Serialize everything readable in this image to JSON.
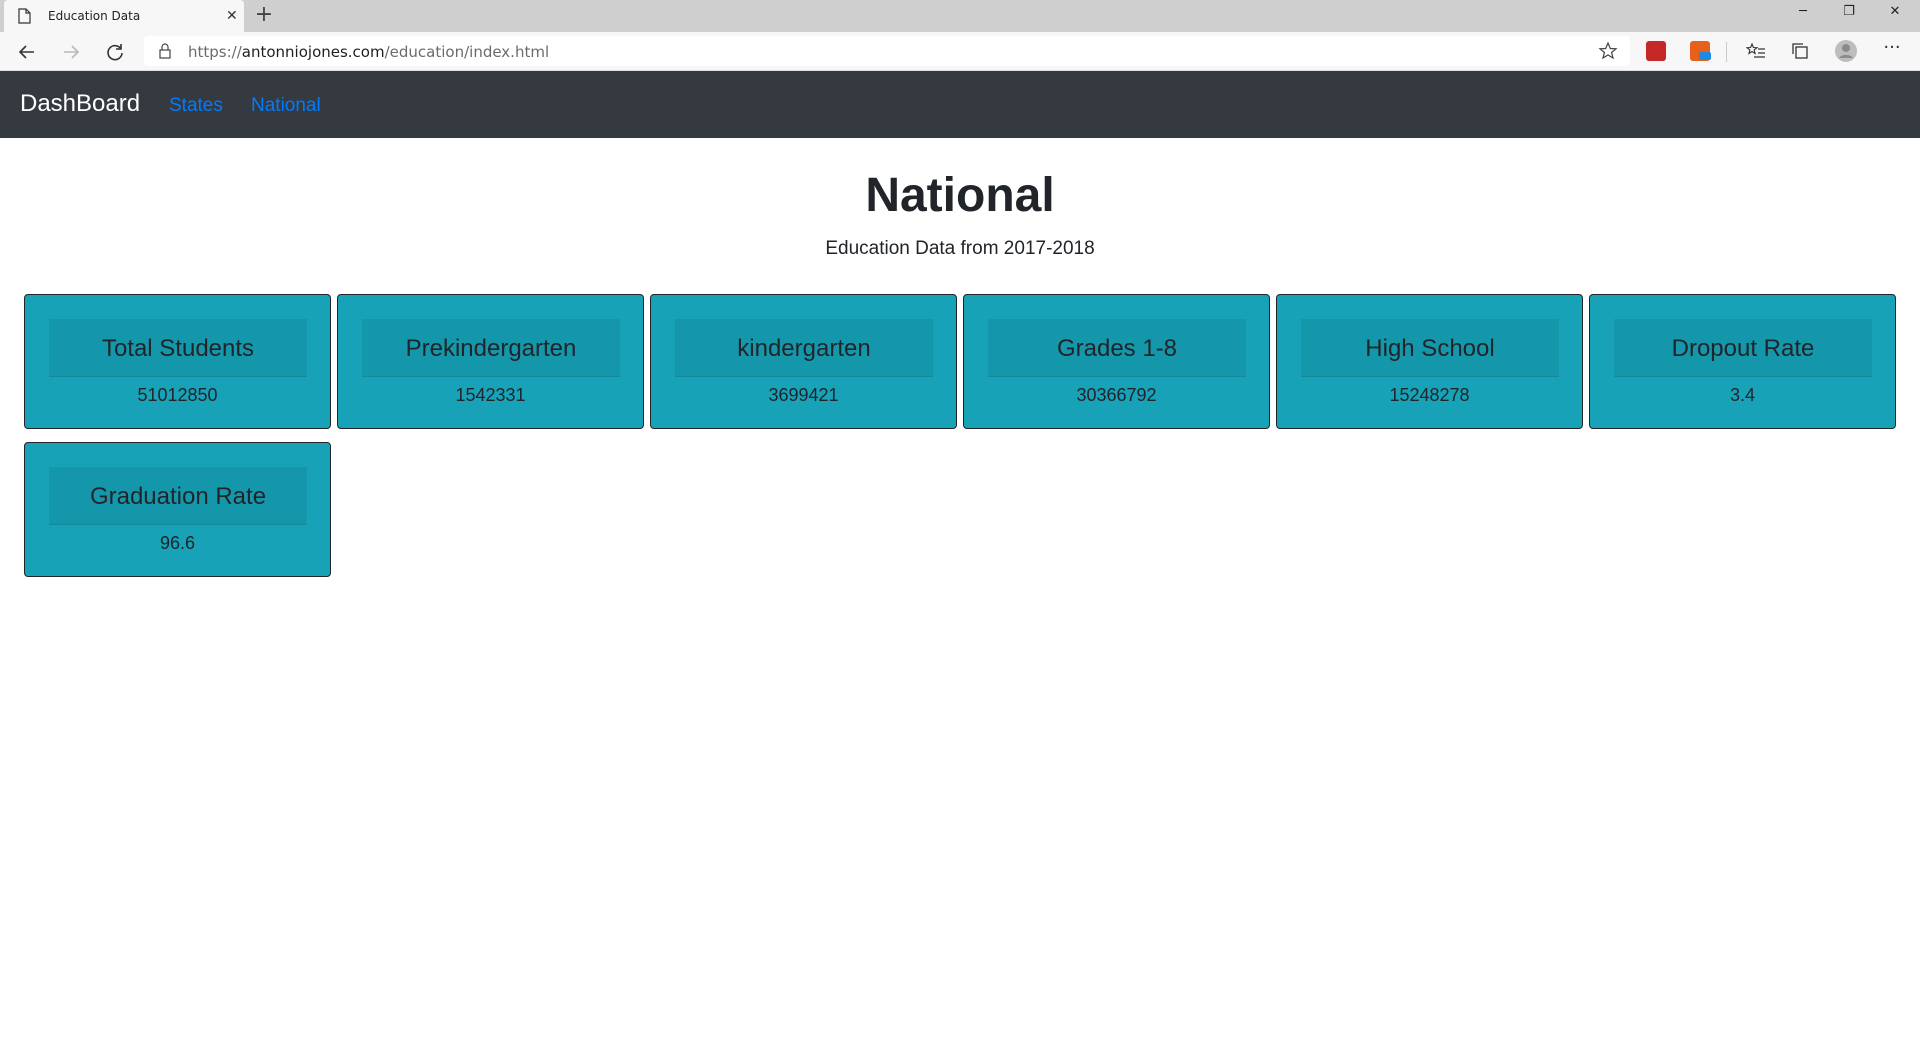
{
  "browser": {
    "tab_title": "Education Data",
    "url_prefix": "https://",
    "url_host": "antonniojones.com",
    "url_path": "/education/index.html"
  },
  "navbar": {
    "brand": "DashBoard",
    "links": [
      "States",
      "National"
    ]
  },
  "main": {
    "title": "National",
    "subtitle": "Education Data from 2017-2018",
    "cards": [
      {
        "title": "Total Students",
        "value": "51012850"
      },
      {
        "title": "Prekindergarten",
        "value": "1542331"
      },
      {
        "title": "kindergarten",
        "value": "3699421"
      },
      {
        "title": "Grades 1-8",
        "value": "30366792"
      },
      {
        "title": "High School",
        "value": "15248278"
      },
      {
        "title": "Dropout Rate",
        "value": "3.4"
      },
      {
        "title": "Graduation Rate",
        "value": "96.6"
      }
    ]
  },
  "colors": {
    "navbar_bg": "#343a40",
    "link": "#007bff",
    "card_bg": "#17a2b8",
    "card_header_bg": "#1597ab"
  }
}
